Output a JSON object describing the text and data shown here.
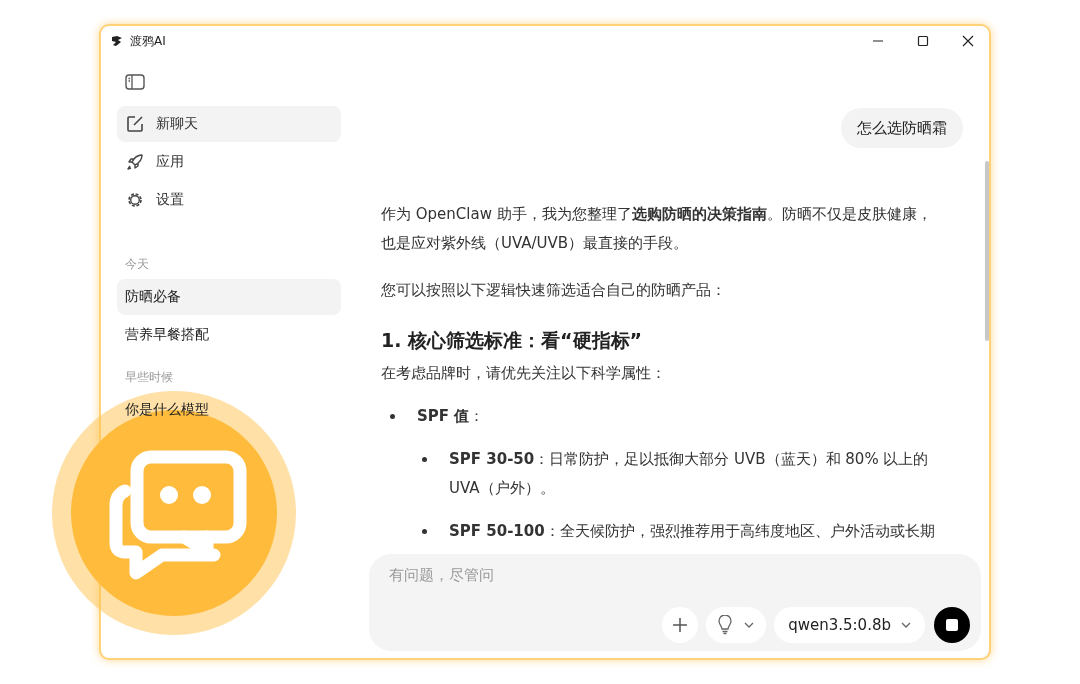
{
  "window": {
    "title": "渡鸦AI"
  },
  "sidebar": {
    "nav": [
      {
        "label": "新聊天",
        "kind": "new",
        "selected": true
      },
      {
        "label": "应用",
        "kind": "apps",
        "selected": false
      },
      {
        "label": "设置",
        "kind": "settings",
        "selected": false
      }
    ],
    "history": [
      {
        "heading": "今天",
        "items": [
          {
            "title": "防晒必备",
            "selected": true
          },
          {
            "title": "营养早餐搭配",
            "selected": false
          }
        ]
      },
      {
        "heading": "早些时候",
        "items": [
          {
            "title": "你是什么模型",
            "selected": false
          }
        ]
      }
    ]
  },
  "chat": {
    "user_message": "怎么选防晒霜",
    "reply": [
      {
        "kind": "paragraph",
        "text": "作为 OpenClaw 助手，我为您整理了**选购防晒的决策指南**。防晒不仅是皮肤健康，也是应对紫外线（UVA/UVB）最直接的手段。"
      },
      {
        "kind": "paragraph",
        "text": "您可以按照以下逻辑快速筛选适合自己的防晒产品："
      },
      {
        "kind": "heading",
        "text": "1. 核心筛选标准：看“硬指标”"
      },
      {
        "kind": "lead",
        "text": "在考虑品牌时，请优先关注以下科学属性："
      },
      {
        "kind": "bullet",
        "text": "**SPF 值**：",
        "children": [
          {
            "text": "**SPF 30-50**：日常防护，足以抵御大部分 UVB（蓝天）和 80% 以上的 UVA（户外）。"
          },
          {
            "text": "**SPF 50-100**：全天候防护，强烈推荐用于高纬度地区、户外活动或长期"
          }
        ]
      }
    ]
  },
  "composer": {
    "placeholder": "有问题，尽管问",
    "model": "qwen3.5:0.8b"
  }
}
